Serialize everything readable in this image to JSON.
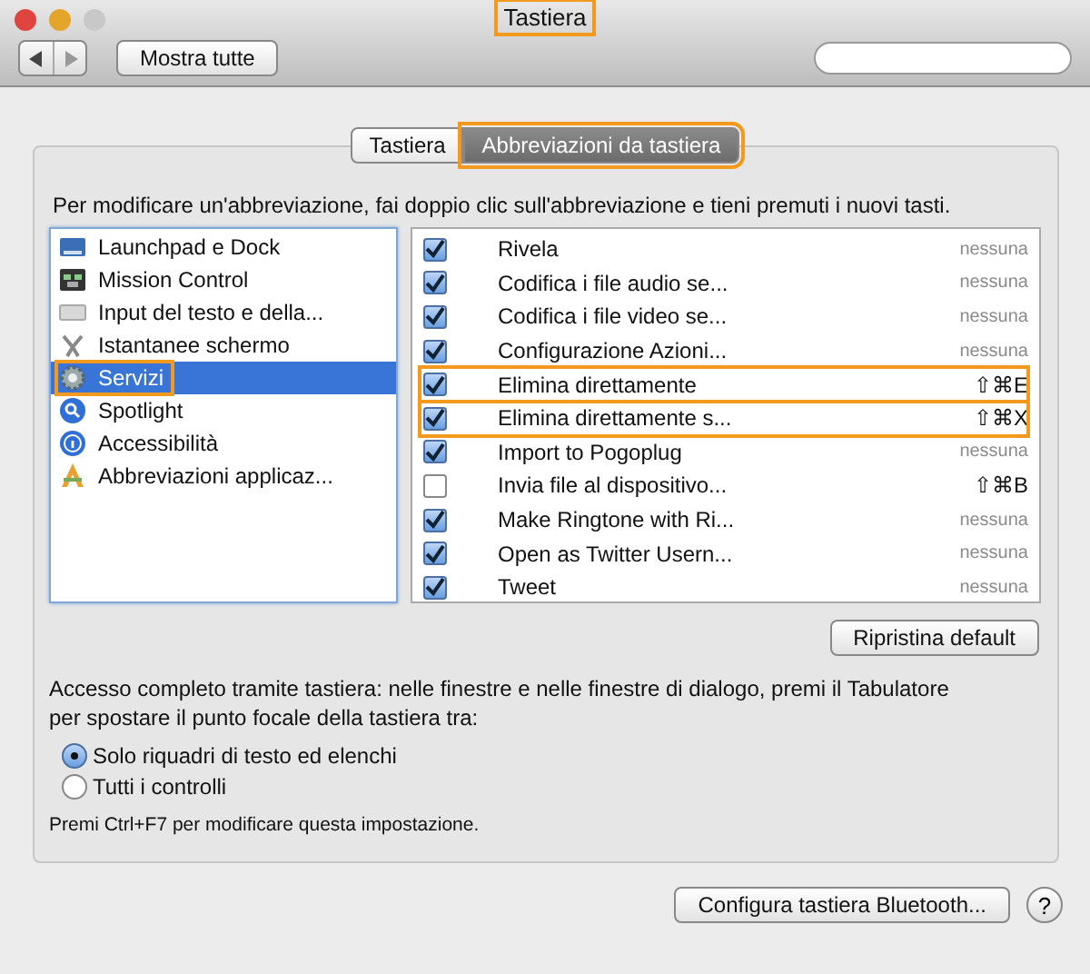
{
  "window": {
    "title": "Tastiera",
    "title_highlighted": true
  },
  "toolbar": {
    "show_all": "Mostra tutte"
  },
  "tabs": [
    {
      "label": "Tastiera",
      "selected": false,
      "highlighted": false
    },
    {
      "label": "Abbreviazioni da tastiera",
      "selected": true,
      "highlighted": true
    }
  ],
  "instruction": "Per modificare un'abbreviazione, fai doppio clic sull'abbreviazione e tieni premuti i nuovi tasti.",
  "sidebar": {
    "items": [
      {
        "label": "Launchpad e Dock",
        "selected": false,
        "highlighted": false
      },
      {
        "label": "Mission Control",
        "selected": false,
        "highlighted": false
      },
      {
        "label": "Input del testo e della...",
        "selected": false,
        "highlighted": false
      },
      {
        "label": "Istantanee schermo",
        "selected": false,
        "highlighted": false
      },
      {
        "label": "Servizi",
        "selected": true,
        "highlighted": true
      },
      {
        "label": "Spotlight",
        "selected": false,
        "highlighted": false
      },
      {
        "label": "Accessibilità",
        "selected": false,
        "highlighted": false
      },
      {
        "label": "Abbreviazioni applicaz...",
        "selected": false,
        "highlighted": false
      }
    ]
  },
  "shortcuts": [
    {
      "name": "Rivela",
      "checked": true,
      "shortcut": "nessuna",
      "assigned": false,
      "highlighted": false
    },
    {
      "name": "Codifica i file audio se...",
      "checked": true,
      "shortcut": "nessuna",
      "assigned": false,
      "highlighted": false
    },
    {
      "name": "Codifica i file video se...",
      "checked": true,
      "shortcut": "nessuna",
      "assigned": false,
      "highlighted": false
    },
    {
      "name": "Configurazione Azioni...",
      "checked": true,
      "shortcut": "nessuna",
      "assigned": false,
      "highlighted": false
    },
    {
      "name": "Elimina direttamente",
      "checked": true,
      "shortcut": "⇧⌘E",
      "assigned": true,
      "highlighted": true
    },
    {
      "name": "Elimina direttamente s...",
      "checked": true,
      "shortcut": "⇧⌘X",
      "assigned": true,
      "highlighted": true
    },
    {
      "name": "Import to Pogoplug",
      "checked": true,
      "shortcut": "nessuna",
      "assigned": false,
      "highlighted": false
    },
    {
      "name": "Invia file al dispositivo...",
      "checked": false,
      "shortcut": "⇧⌘B",
      "assigned": true,
      "highlighted": false
    },
    {
      "name": "Make Ringtone with Ri...",
      "checked": true,
      "shortcut": "nessuna",
      "assigned": false,
      "highlighted": false
    },
    {
      "name": "Open as Twitter Usern...",
      "checked": true,
      "shortcut": "nessuna",
      "assigned": false,
      "highlighted": false
    },
    {
      "name": "Tweet",
      "checked": true,
      "shortcut": "nessuna",
      "assigned": false,
      "highlighted": false
    }
  ],
  "restore_button": "Ripristina default",
  "full_access": {
    "text": "Accesso completo tramite tastiera: nelle finestre e nelle finestre di dialogo, premi il Tabulatore per spostare il punto focale della tastiera tra:",
    "options": [
      {
        "label": "Solo riquadri di testo ed elenchi",
        "selected": true
      },
      {
        "label": "Tutti i controlli",
        "selected": false
      }
    ],
    "note": "Premi Ctrl+F7 per modificare questa impostazione."
  },
  "bluetooth_button": "Configura tastiera Bluetooth...",
  "help_button": "?"
}
